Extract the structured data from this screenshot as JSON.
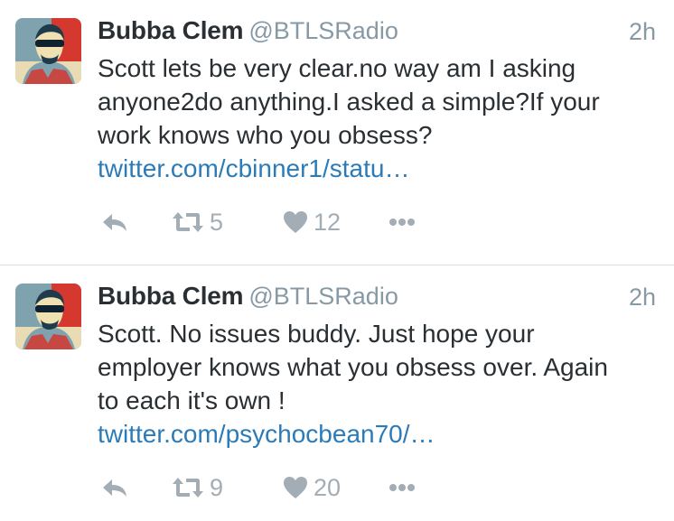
{
  "tweets": [
    {
      "author_name": "Bubba Clem",
      "author_handle": "@BTLSRadio",
      "time": "2h",
      "text_lines": [
        "Scott lets be very clear.no way am I asking",
        "anyone2do anything.I asked a simple?If your",
        "work knows who you obsess?"
      ],
      "link": "twitter.com/cbinner1/statu…",
      "retweets": "5",
      "likes": "12"
    },
    {
      "author_name": "Bubba Clem",
      "author_handle": "@BTLSRadio",
      "time": "2h",
      "text_lines": [
        "Scott. No issues buddy. Just hope your",
        "employer knows what you obsess over. Again",
        "to each it's own !"
      ],
      "link": "twitter.com/psychocbean70/…",
      "retweets": "9",
      "likes": "20"
    }
  ],
  "icons": {
    "reply": "reply-icon",
    "retweet": "retweet-icon",
    "like": "heart-icon",
    "more": "more-dots-icon"
  },
  "colors": {
    "name": "#292f33",
    "meta": "#8899a6",
    "link": "#2b7bb9",
    "action": "#a2adb5",
    "divider": "#d8dde1"
  }
}
